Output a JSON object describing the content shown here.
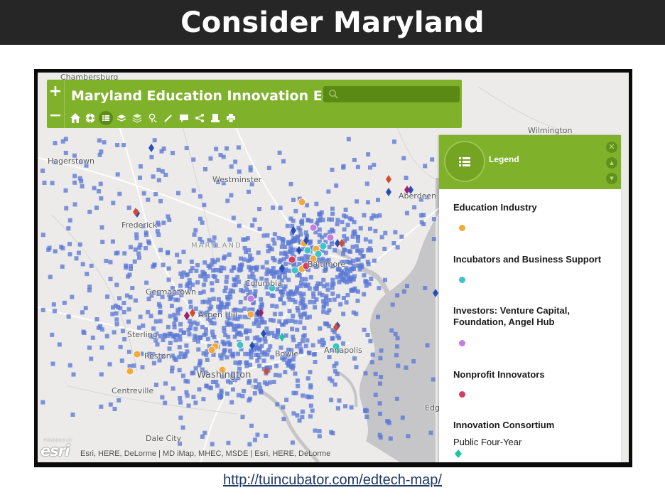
{
  "slide": {
    "title": "Consider Maryland",
    "link": "http://tuincubator.com/edtech-map/"
  },
  "app": {
    "title": "Maryland Education Innovation Ec...",
    "search_placeholder": "",
    "zoom_in": "+",
    "zoom_out": "−",
    "tools": [
      "home-icon",
      "locate-icon",
      "legend-list-icon",
      "layers-icon",
      "basemap-icon",
      "bookmark-pin-icon",
      "measure-pencil-icon",
      "comment-icon",
      "share-icon",
      "print-preview-icon",
      "print-icon"
    ],
    "colors": {
      "toolbar_green": "#7fb12b",
      "dark_green": "#5a8a14"
    }
  },
  "map": {
    "state_label": "MARYLAND",
    "places": [
      "Chambersburg",
      "Hagerstown",
      "Westminster",
      "Frederick",
      "Germantown",
      "Aspen Hill",
      "Sterling",
      "Reston",
      "Centreville",
      "Washington",
      "Bowie",
      "Annapolis",
      "Columbia",
      "Baltimore",
      "Aberdeen",
      "Wilmington",
      "Dale City",
      "Edge"
    ],
    "attribution": "Esri, HERE, DeLorme | MD iMap, MHEC, MSDE | Esri, HERE, DeLorme",
    "logo": "esri",
    "logo_sub": "POWERED BY"
  },
  "legend": {
    "title": "Legend",
    "items": [
      {
        "name": "Education Industry",
        "color": "#f2a93b"
      },
      {
        "name": "Incubators and Business Support",
        "color": "#3cc4c6"
      },
      {
        "name": "Investors: Venture Capital, Foundation, Angel Hub",
        "color": "#c77ce0"
      },
      {
        "name": "Nonprofit Innovators",
        "color": "#d6405c"
      },
      {
        "name": "Innovation Consortium",
        "color": "#19c7a1",
        "sub": "Public Four-Year"
      }
    ]
  }
}
